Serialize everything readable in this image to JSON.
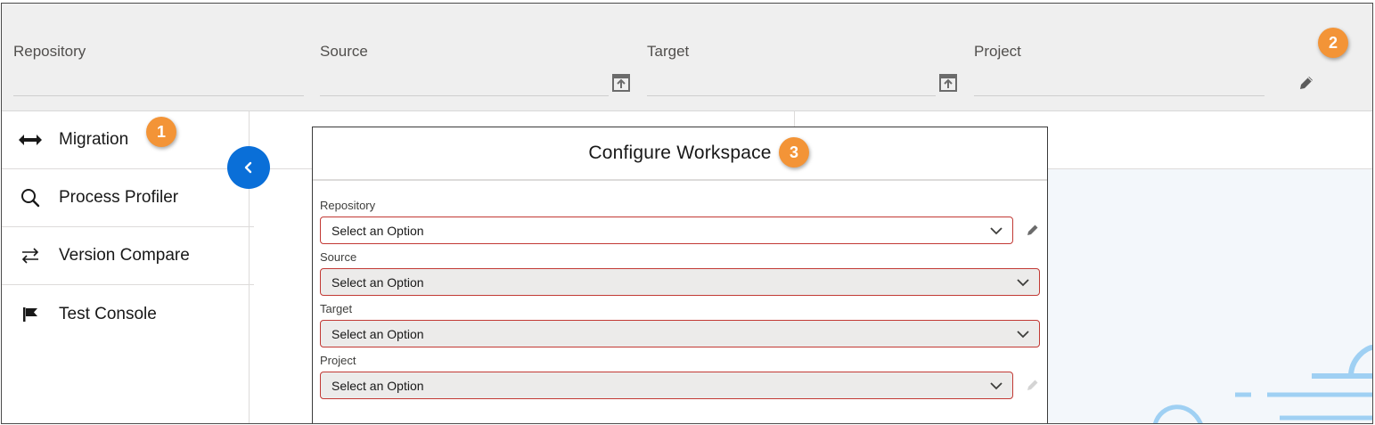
{
  "header": {
    "fields": [
      {
        "label": "Repository"
      },
      {
        "label": "Source"
      },
      {
        "label": "Target"
      },
      {
        "label": "Project"
      }
    ],
    "badge": "2"
  },
  "sidebar": {
    "items": [
      {
        "label": "Migration",
        "icon": "double-arrow-icon"
      },
      {
        "label": "Process Profiler",
        "icon": "search-icon"
      },
      {
        "label": "Version Compare",
        "icon": "swap-arrows-icon"
      },
      {
        "label": "Test Console",
        "icon": "flag-icon"
      }
    ],
    "badge": "1"
  },
  "modal": {
    "title": "Configure Workspace",
    "badge": "3",
    "fields": [
      {
        "label": "Repository",
        "placeholder": "Select an Option",
        "disabled": false
      },
      {
        "label": "Source",
        "placeholder": "Select an Option",
        "disabled": true
      },
      {
        "label": "Target",
        "placeholder": "Select an Option",
        "disabled": true
      },
      {
        "label": "Project",
        "placeholder": "Select an Option",
        "disabled": true
      }
    ]
  },
  "colors": {
    "accent_badge": "#f39437",
    "collapse_button": "#0a6fd8",
    "error_border": "#c23934",
    "header_bg": "#efefef"
  }
}
